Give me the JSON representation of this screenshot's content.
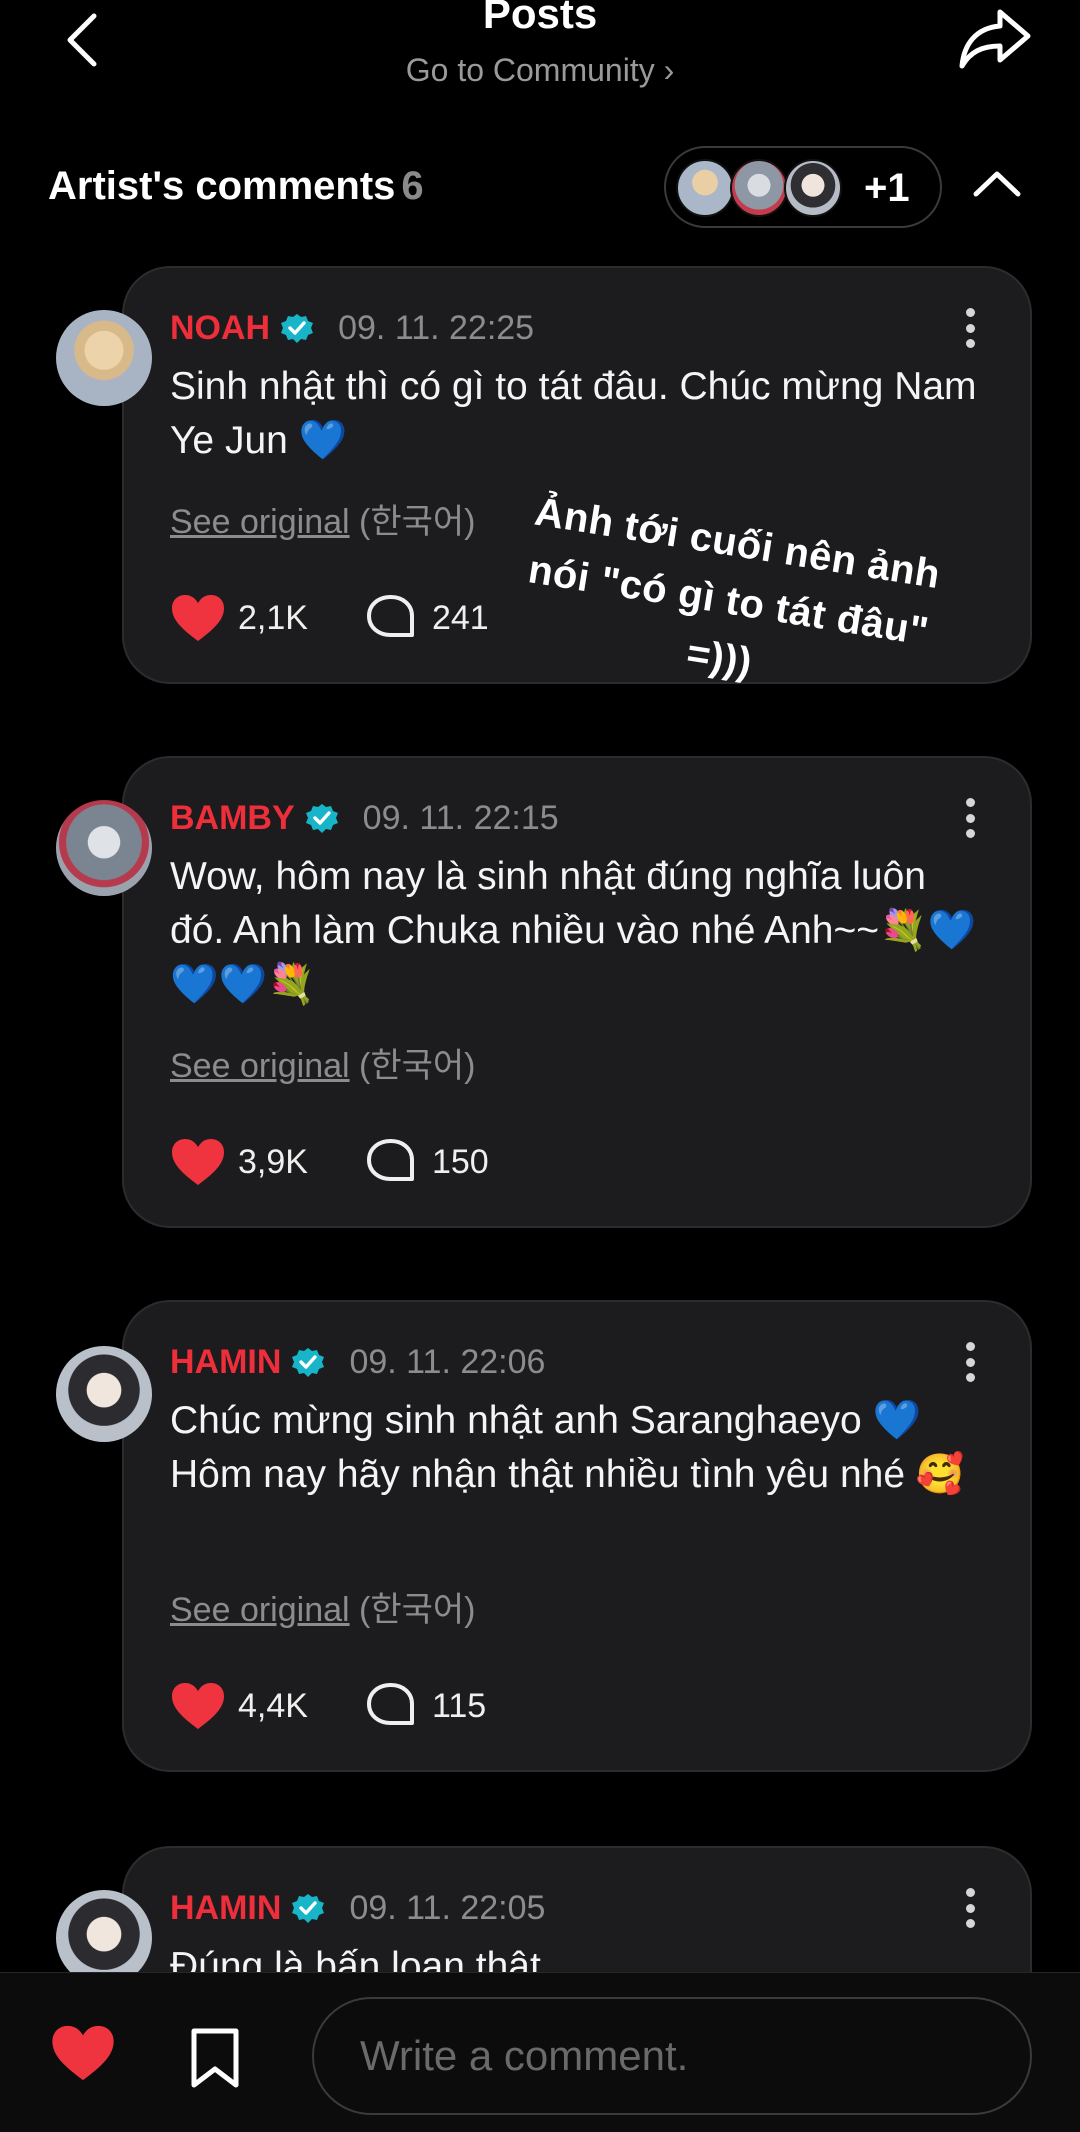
{
  "header": {
    "title": "Posts",
    "subtitle": "Go to Community ›"
  },
  "artist_comments": {
    "title": "Artist's comments",
    "count": "6",
    "more_label": "+1"
  },
  "comments": [
    {
      "author": "NOAH",
      "time": "09. 11. 22:25",
      "text": "Sinh nhật thì có gì to tát đâu. Chúc mừng Nam Ye Jun 💙",
      "see_original": "See original",
      "language": "(한국어)",
      "likes": "2,1K",
      "replies": "241"
    },
    {
      "author": "BAMBY",
      "time": "09. 11. 22:15",
      "text": "Wow, hôm nay là sinh nhật đúng nghĩa luôn đó. Anh làm Chuka nhiều vào nhé Anh~~💐💙💙💙💐",
      "see_original": "See original",
      "language": "(한국어)",
      "likes": "3,9K",
      "replies": "150"
    },
    {
      "author": "HAMIN",
      "time": "09. 11. 22:06",
      "text": "Chúc mừng sinh nhật anh Saranghaeyo 💙 Hôm nay hãy nhận thật nhiều tình yêu nhé 🥰",
      "see_original": "See original",
      "language": "(한국어)",
      "likes": "4,4K",
      "replies": "115"
    },
    {
      "author": "HAMIN",
      "time": "09. 11. 22:05",
      "text": "Đúng là bấn loạn thật"
    }
  ],
  "overlay_caption": "Ảnh tới cuối nên ảnh nói \"có gì to tát đâu\" =)))",
  "bottom_bar": {
    "comment_placeholder": "Write a comment."
  },
  "colors": {
    "background": "#000000",
    "card": "#1c1c1e",
    "author_red": "#ee2e3a",
    "verified_teal": "#18b4c8",
    "heart_red": "#f0343f"
  },
  "icons": [
    "back-arrow-icon",
    "share-icon",
    "chevron-up-icon",
    "verified-icon",
    "more-vertical-icon",
    "heart-icon",
    "reply-bubble-icon",
    "bookmark-icon"
  ]
}
